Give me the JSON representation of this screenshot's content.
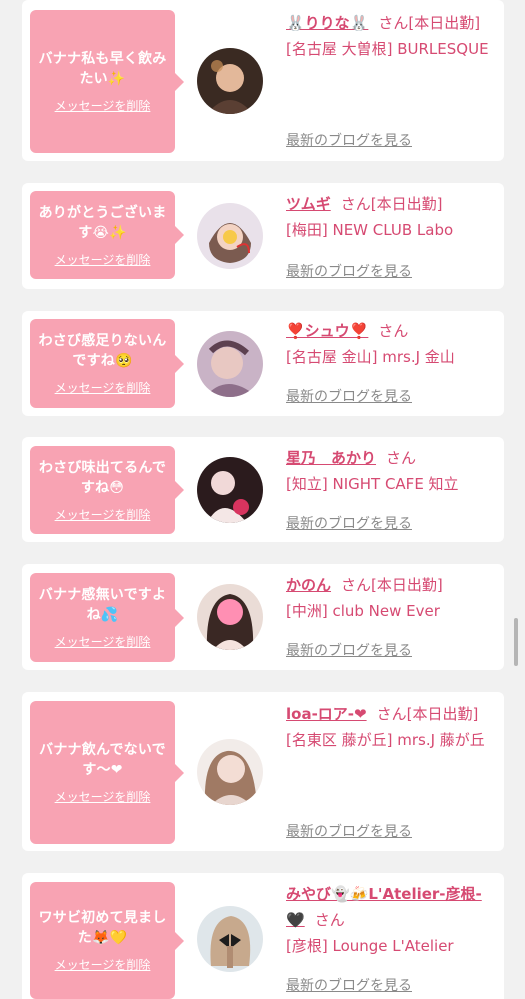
{
  "delete_label": "メッセージを削除",
  "blog_label": "最新のブログを見る",
  "san_label": "さん",
  "cards": [
    {
      "message": "バナナ私も早く飲みたい✨",
      "name": "🐰りりな🐰",
      "status": "[本日出勤]",
      "shop": "[名古屋 大曽根] BURLESQUE"
    },
    {
      "message": "ありがとうございます😭✨",
      "name": "ツムギ",
      "status": "[本日出勤]",
      "shop": "[梅田] NEW CLUB Labo"
    },
    {
      "message": "わさび感足りないんですね🥺",
      "name": "❣️シュウ❣️",
      "status": "",
      "shop": "[名古屋 金山] mrs.J 金山"
    },
    {
      "message": "わさび味出てるんですね😳",
      "name": "星乃　あかり",
      "status": "",
      "shop": "[知立] NIGHT CAFE 知立"
    },
    {
      "message": "バナナ感無いですよね💦",
      "name": "かのん",
      "status": "[本日出勤]",
      "shop": "[中洲] club New Ever"
    },
    {
      "message": "バナナ飲んでないです〜❤",
      "name": "loa-ロア-❤",
      "status": "[本日出勤]",
      "shop": "[名東区 藤が丘] mrs.J 藤が丘"
    },
    {
      "message": "ワサビ初めて見ました🦊💛",
      "name": "みやび👻🍻L'Atelier-彦根-🖤",
      "status": "",
      "shop": "[彦根] Lounge L'Atelier"
    }
  ],
  "colors": {
    "accent": "#d64a72",
    "bubble": "#f8a3b3",
    "background": "#f1f1f1"
  }
}
